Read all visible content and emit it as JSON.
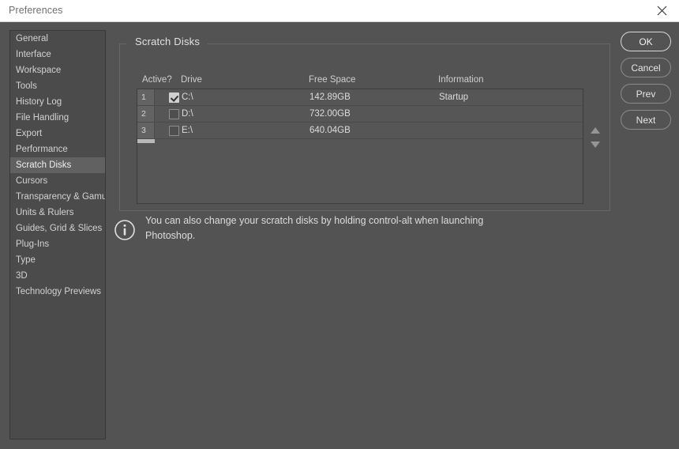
{
  "window": {
    "title": "Preferences",
    "close_icon": "close-icon"
  },
  "sidebar": {
    "items": [
      {
        "label": "General",
        "selected": false
      },
      {
        "label": "Interface",
        "selected": false
      },
      {
        "label": "Workspace",
        "selected": false
      },
      {
        "label": "Tools",
        "selected": false
      },
      {
        "label": "History Log",
        "selected": false
      },
      {
        "label": "File Handling",
        "selected": false
      },
      {
        "label": "Export",
        "selected": false
      },
      {
        "label": "Performance",
        "selected": false
      },
      {
        "label": "Scratch Disks",
        "selected": true
      },
      {
        "label": "Cursors",
        "selected": false
      },
      {
        "label": "Transparency & Gamut",
        "selected": false
      },
      {
        "label": "Units & Rulers",
        "selected": false
      },
      {
        "label": "Guides, Grid & Slices",
        "selected": false
      },
      {
        "label": "Plug-Ins",
        "selected": false
      },
      {
        "label": "Type",
        "selected": false
      },
      {
        "label": "3D",
        "selected": false
      },
      {
        "label": "Technology Previews",
        "selected": false
      }
    ]
  },
  "main": {
    "group_title": "Scratch Disks",
    "table": {
      "columns": [
        "Active?",
        "Drive",
        "Free Space",
        "Information"
      ],
      "rows": [
        {
          "num": "1",
          "active": true,
          "drive": "C:\\",
          "free_space": "142.89GB",
          "information": "Startup"
        },
        {
          "num": "2",
          "active": false,
          "drive": "D:\\",
          "free_space": "732.00GB",
          "information": ""
        },
        {
          "num": "3",
          "active": false,
          "drive": "E:\\",
          "free_space": "640.04GB",
          "information": ""
        }
      ]
    },
    "reorder": {
      "up_icon": "triangle-up-icon",
      "down_icon": "triangle-down-icon"
    },
    "note": {
      "icon": "info-circle-icon",
      "text": "You can also change your scratch disks by holding control-alt when launching Photoshop."
    }
  },
  "buttons": [
    {
      "label": "OK",
      "primary": true
    },
    {
      "label": "Cancel",
      "primary": false
    },
    {
      "label": "Prev",
      "primary": false
    },
    {
      "label": "Next",
      "primary": false
    }
  ],
  "colors": {
    "dialog_background": "#535353",
    "titlebar_background": "#ffffff",
    "sidebar_background": "#4b4b4b",
    "sidebar_selected": "#616161",
    "table_background": "#565656",
    "text": "#dcdcdc"
  }
}
